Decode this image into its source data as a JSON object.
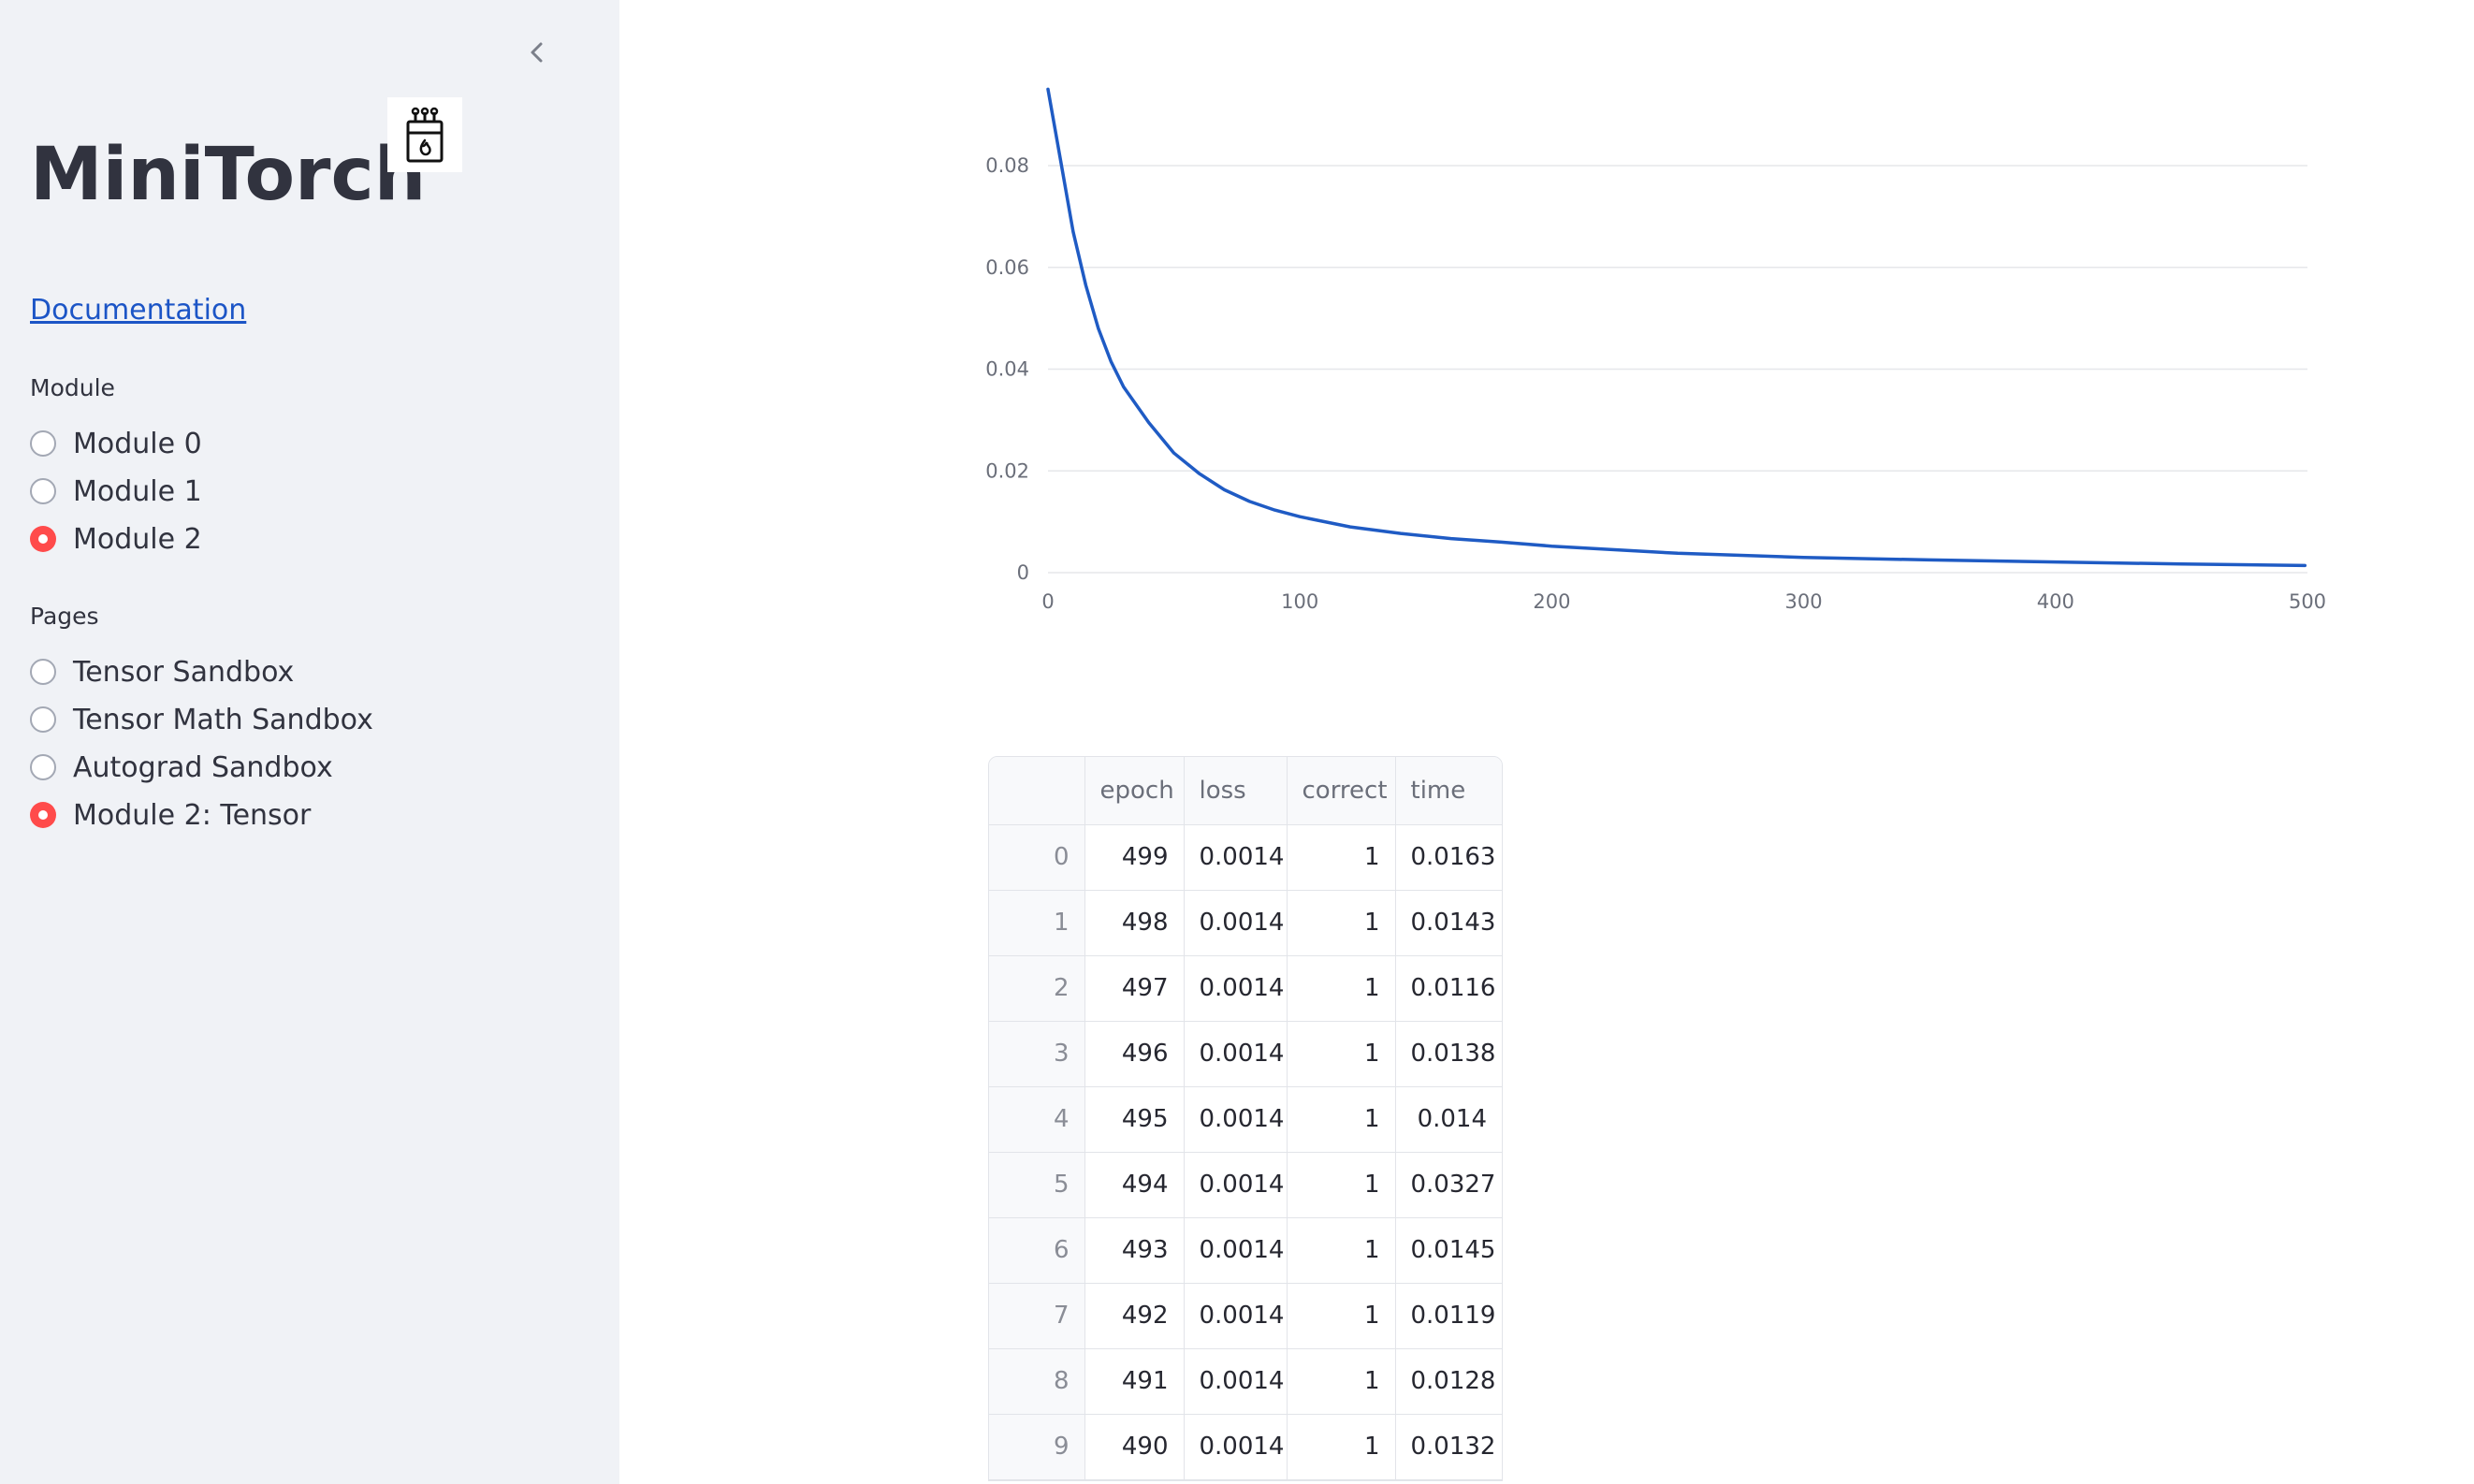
{
  "sidebar": {
    "title": "MiniTorch",
    "doc_link": "Documentation",
    "module_group": {
      "label": "Module",
      "options": [
        {
          "label": "Module 0",
          "selected": false
        },
        {
          "label": "Module 1",
          "selected": false
        },
        {
          "label": "Module 2",
          "selected": true
        }
      ]
    },
    "pages_group": {
      "label": "Pages",
      "options": [
        {
          "label": "Tensor Sandbox",
          "selected": false
        },
        {
          "label": "Tensor Math Sandbox",
          "selected": false
        },
        {
          "label": "Autograd Sandbox",
          "selected": false
        },
        {
          "label": "Module 2: Tensor",
          "selected": true
        }
      ]
    },
    "icons": {
      "collapse": "chevron-left-icon",
      "logo": "matchbox-logo-icon"
    }
  },
  "colors": {
    "accent": "#ff4b4b",
    "line": "#1f5bc4",
    "link": "#1c55c6",
    "sidebar_bg": "#f0f2f6"
  },
  "chart_data": {
    "type": "line",
    "xlim": [
      0,
      500
    ],
    "ylim": [
      0,
      0.096
    ],
    "x_ticks": [
      "0",
      "100",
      "200",
      "300",
      "400",
      "500"
    ],
    "y_ticks": [
      "0",
      "0.02",
      "0.04",
      "0.06",
      "0.08"
    ],
    "grid": true,
    "series": [
      {
        "x": [
          0,
          5,
          10,
          15,
          20,
          25,
          30,
          40,
          50,
          60,
          70,
          80,
          90,
          100,
          120,
          140,
          160,
          180,
          200,
          250,
          300,
          350,
          400,
          450,
          499
        ],
        "y": [
          0.095,
          0.081,
          0.067,
          0.0565,
          0.048,
          0.0415,
          0.0365,
          0.0295,
          0.0235,
          0.0195,
          0.0163,
          0.014,
          0.0123,
          0.011,
          0.009,
          0.0077,
          0.0067,
          0.006,
          0.0052,
          0.0038,
          0.003,
          0.0025,
          0.0021,
          0.0017,
          0.0014
        ]
      }
    ]
  },
  "table": {
    "columns": [
      "",
      "epoch",
      "loss",
      "correct",
      "time"
    ],
    "rows": [
      [
        "0",
        "499",
        "0.0014",
        "1",
        "0.0163"
      ],
      [
        "1",
        "498",
        "0.0014",
        "1",
        "0.0143"
      ],
      [
        "2",
        "497",
        "0.0014",
        "1",
        "0.0116"
      ],
      [
        "3",
        "496",
        "0.0014",
        "1",
        "0.0138"
      ],
      [
        "4",
        "495",
        "0.0014",
        "1",
        "0.014"
      ],
      [
        "5",
        "494",
        "0.0014",
        "1",
        "0.0327"
      ],
      [
        "6",
        "493",
        "0.0014",
        "1",
        "0.0145"
      ],
      [
        "7",
        "492",
        "0.0014",
        "1",
        "0.0119"
      ],
      [
        "8",
        "491",
        "0.0014",
        "1",
        "0.0128"
      ],
      [
        "9",
        "490",
        "0.0014",
        "1",
        "0.0132"
      ]
    ]
  }
}
